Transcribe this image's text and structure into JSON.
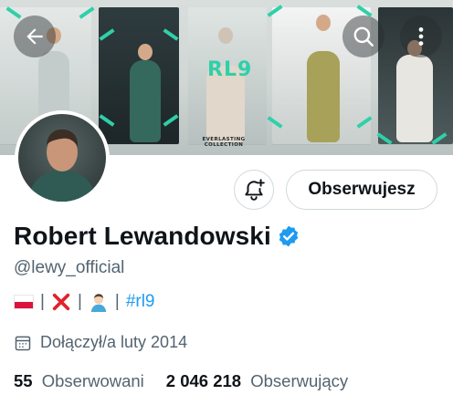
{
  "banner": {
    "logo_text": "RL9",
    "collection_text": "EVERLASTING COLLECTION",
    "accent_color": "#2fd0a9"
  },
  "nav": {
    "back_icon": "arrow-left-icon",
    "search_icon": "search-icon",
    "more_icon": "more-vertical-icon"
  },
  "actions": {
    "notify_icon": "bell-plus-icon",
    "follow_label": "Obserwujesz"
  },
  "profile": {
    "name": "Robert Lewandowski",
    "verified": true,
    "verified_color": "#1d9bf0",
    "handle": "@lewy_official",
    "bio": {
      "separator": "|",
      "hashtag": "#rl9",
      "icons": [
        "poland-flag-icon",
        "cross-mark-icon",
        "man-emoji-icon"
      ]
    },
    "joined_text": "Dołączył/a luty 2014",
    "following_count": "55",
    "following_label": "Obserwowani",
    "followers_count": "2 046 218",
    "followers_label": "Obserwujący"
  }
}
